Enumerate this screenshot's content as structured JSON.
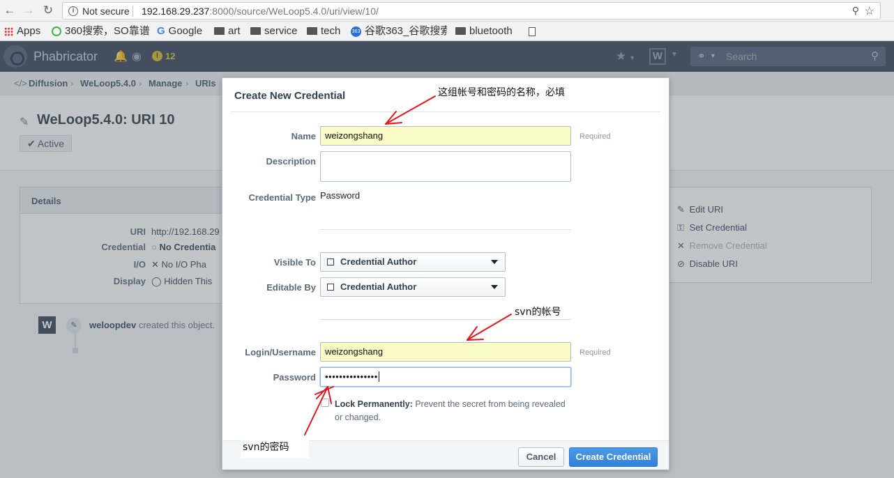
{
  "browser": {
    "back_icon": "arrow-left-icon",
    "forward_icon": "arrow-right-icon",
    "reload_icon": "reload-icon",
    "security_text": "Not secure",
    "url_host": "192.168.29.237",
    "url_rest": ":8000/source/WeLoop5.4.0/uri/view/10/"
  },
  "bookmarks": [
    {
      "label": "Apps",
      "icon": "apps-grid-icon"
    },
    {
      "label": "360搜索，SO靠谱",
      "icon": "360-icon"
    },
    {
      "label": "Google",
      "icon": "google-icon"
    },
    {
      "label": "art",
      "icon": "folder-icon"
    },
    {
      "label": "service",
      "icon": "folder-icon"
    },
    {
      "label": "tech",
      "icon": "folder-icon"
    },
    {
      "label": "谷歌363_谷歌搜索",
      "icon": "363-icon"
    },
    {
      "label": "bluetooth",
      "icon": "folder-icon"
    }
  ],
  "topbar": {
    "brand": "Phabricator",
    "alert_count": "12",
    "app_button": "W",
    "search_placeholder": "Search"
  },
  "breadcrumbs": [
    "Diffusion",
    "WeLoop5.4.0",
    "Manage",
    "URIs"
  ],
  "page": {
    "title": "WeLoop5.4.0: URI 10",
    "status": "Active"
  },
  "details": {
    "heading": "Details",
    "rows": [
      {
        "label": "URI",
        "value": "http://192.168.29"
      },
      {
        "label": "Credential",
        "value": "No Credentia"
      },
      {
        "label": "I/O",
        "value": "No I/O  Pha"
      },
      {
        "label": "Display",
        "value": "Hidden  This"
      }
    ]
  },
  "actions": [
    {
      "label": "Edit URI",
      "icon": "pencil-icon",
      "enabled": true
    },
    {
      "label": "Set Credential",
      "icon": "key-icon",
      "enabled": true
    },
    {
      "label": "Remove Credential",
      "icon": "close-icon",
      "enabled": false
    },
    {
      "label": "Disable URI",
      "icon": "ban-icon",
      "enabled": true
    }
  ],
  "timeline": {
    "author": "weloopdev",
    "text": "created this object."
  },
  "dialog": {
    "title": "Create New Credential",
    "name_label": "Name",
    "name_value": "weizongshang",
    "required": "Required",
    "description_label": "Description",
    "type_label": "Credential Type",
    "type_value": "Password",
    "visible_label": "Visible To",
    "visible_value": "Credential Author",
    "editable_label": "Editable By",
    "editable_value": "Credential Author",
    "login_label": "Login/Username",
    "login_value": "weizongshang",
    "password_label": "Password",
    "password_mask": "•••••••••••••••",
    "lock_title": "Lock Permanently:",
    "lock_text": "Prevent the secret from being revealed or changed.",
    "cancel": "Cancel",
    "create": "Create Credential"
  },
  "annotations": {
    "name_note": "这组帐号和密码的名称，必填",
    "login_note": "svn的帐号",
    "password_note": "svn的密码",
    "arrow_color": "#e8151b"
  }
}
